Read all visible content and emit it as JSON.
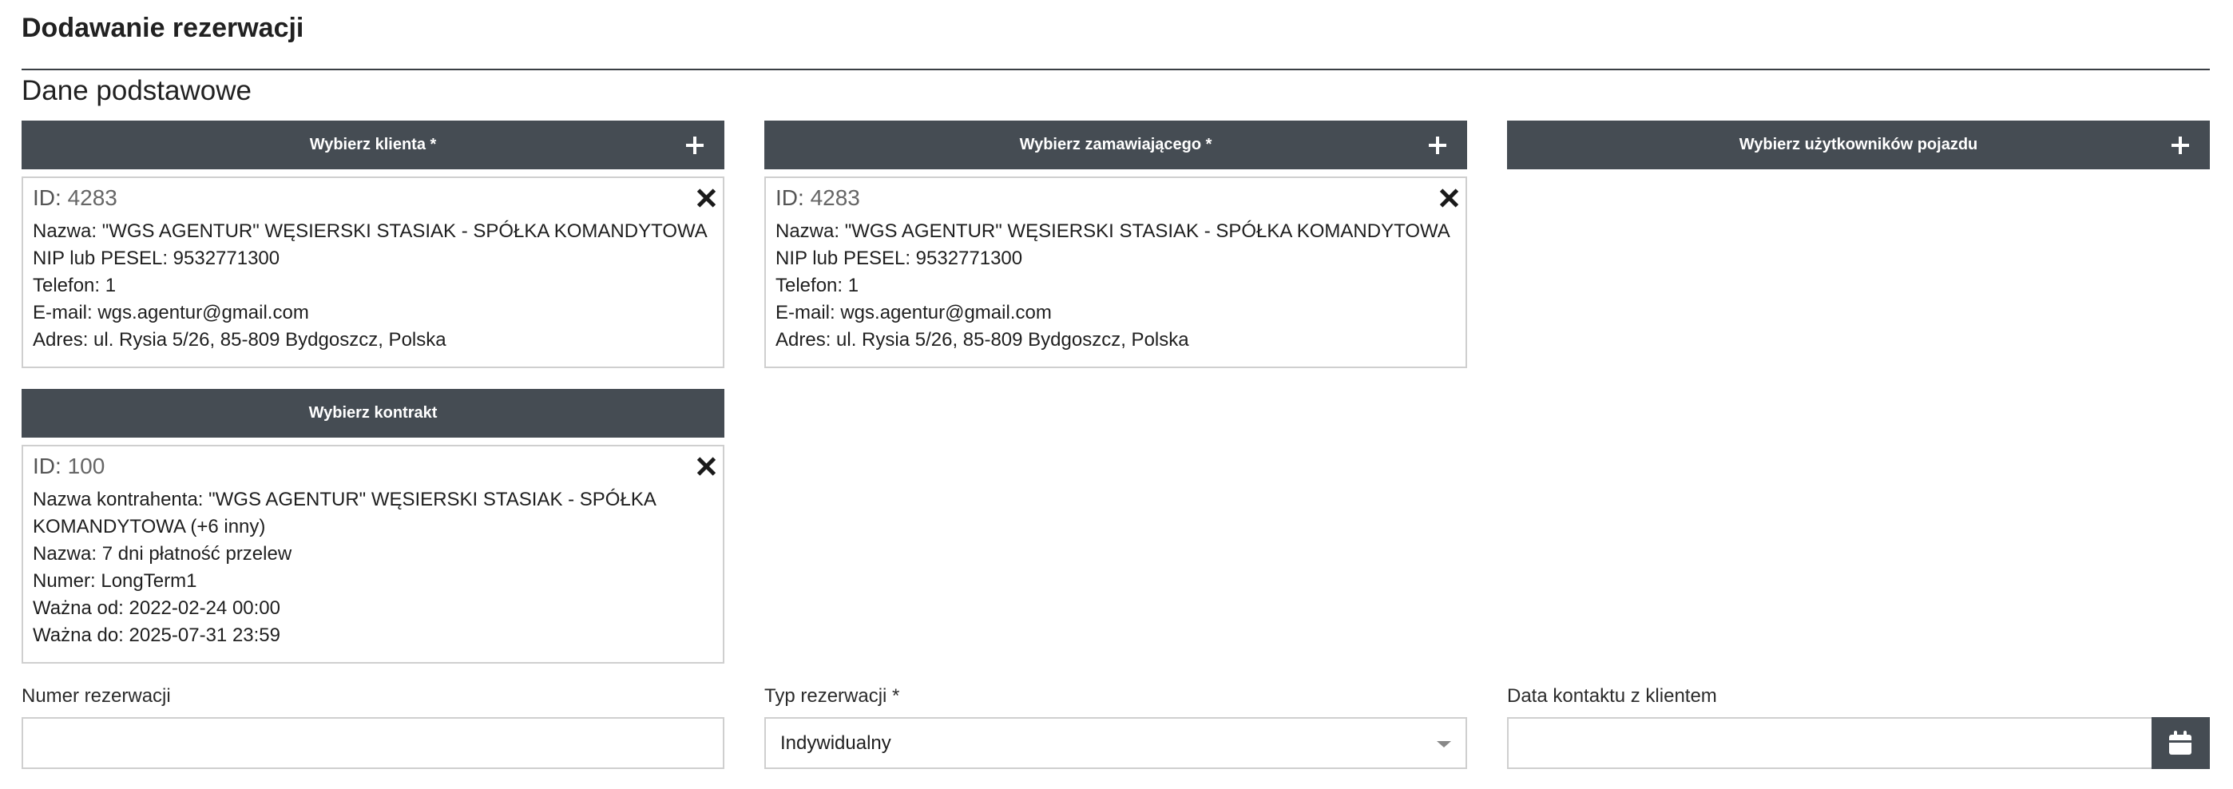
{
  "page": {
    "title": "Dodawanie rezerwacji",
    "section_title": "Dane podstawowe"
  },
  "client_selector": {
    "label": "Wybierz klienta *",
    "card": {
      "id_label": "ID:",
      "id_value": "4283",
      "lines": [
        "Nazwa: \"WGS AGENTUR\" WĘSIERSKI STASIAK - SPÓŁKA KOMANDYTOWA",
        "NIP lub PESEL: 9532771300",
        "Telefon: 1",
        "E-mail: wgs.agentur@gmail.com",
        "Adres: ul. Rysia 5/26, 85-809 Bydgoszcz, Polska"
      ]
    }
  },
  "orderer_selector": {
    "label": "Wybierz zamawiającego *",
    "card": {
      "id_label": "ID:",
      "id_value": "4283",
      "lines": [
        "Nazwa: \"WGS AGENTUR\" WĘSIERSKI STASIAK - SPÓŁKA KOMANDYTOWA",
        "NIP lub PESEL: 9532771300",
        "Telefon: 1",
        "E-mail: wgs.agentur@gmail.com",
        "Adres: ul. Rysia 5/26, 85-809 Bydgoszcz, Polska"
      ]
    }
  },
  "vehicle_users_selector": {
    "label": "Wybierz użytkowników pojazdu"
  },
  "contract_selector": {
    "label": "Wybierz kontrakt",
    "card": {
      "id_label": "ID:",
      "id_value": "100",
      "lines": [
        "Nazwa kontrahenta: \"WGS AGENTUR\" WĘSIERSKI STASIAK - SPÓŁKA",
        "KOMANDYTOWA (+6 inny)",
        "Nazwa: 7 dni płatność przelew",
        "Numer: LongTerm1",
        "Ważna od: 2022-02-24 00:00",
        "Ważna do: 2025-07-31 23:59"
      ]
    }
  },
  "fields": {
    "reservation_number": {
      "label": "Numer rezerwacji",
      "value": ""
    },
    "reservation_type": {
      "label": "Typ rezerwacji *",
      "value": "Indywidualny"
    },
    "contact_date": {
      "label": "Data kontaktu z klientem",
      "value": ""
    }
  },
  "icons": {
    "plus": "plus-icon",
    "close": "close-icon",
    "calendar": "calendar-icon",
    "caret": "chevron-down-icon"
  },
  "colors": {
    "bar_bg": "#454c53",
    "border": "#cfcfcf",
    "text": "#212121"
  }
}
